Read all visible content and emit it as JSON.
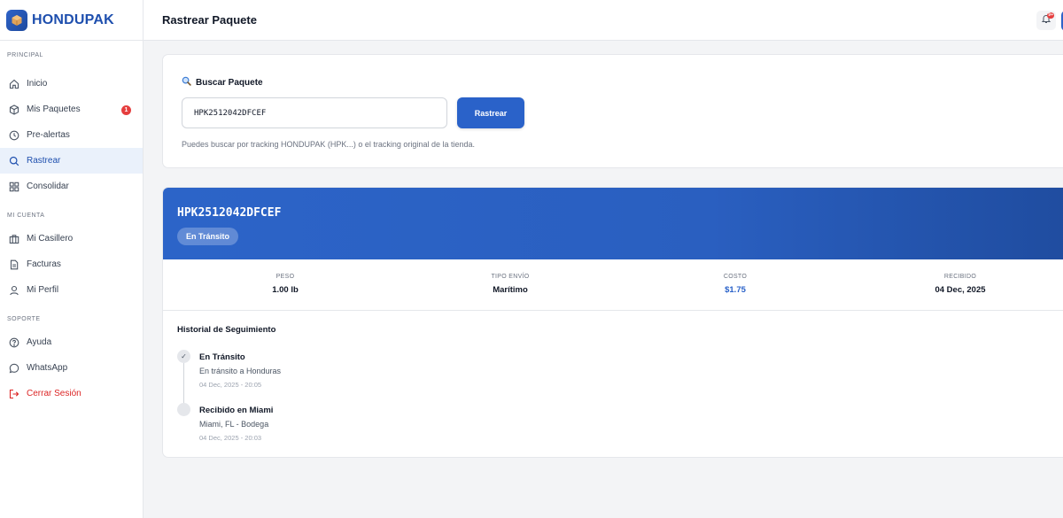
{
  "brand": {
    "name": "HONDUPAK"
  },
  "sidebar": {
    "sections": [
      {
        "label": "PRINCIPAL"
      },
      {
        "label": "MI CUENTA"
      },
      {
        "label": "SOPORTE"
      }
    ],
    "items": [
      {
        "label": "Inicio",
        "icon": "home-icon"
      },
      {
        "label": "Mis Paquetes",
        "icon": "box-icon",
        "badge": "1"
      },
      {
        "label": "Pre-alertas",
        "icon": "clock-icon"
      },
      {
        "label": "Rastrear",
        "icon": "search-icon",
        "active": true
      },
      {
        "label": "Consolidar",
        "icon": "grid-icon"
      },
      {
        "label": "Mi Casillero",
        "icon": "briefcase-icon"
      },
      {
        "label": "Facturas",
        "icon": "document-icon"
      },
      {
        "label": "Mi Perfil",
        "icon": "user-icon"
      },
      {
        "label": "Ayuda",
        "icon": "help-icon"
      },
      {
        "label": "WhatsApp",
        "icon": "chat-icon"
      },
      {
        "label": "Cerrar Sesión",
        "icon": "logout-icon",
        "color": "#dc2626"
      }
    ]
  },
  "header": {
    "title": "Rastrear Paquete",
    "notification_count": "9+"
  },
  "search": {
    "title": "Buscar Paquete",
    "value": "HPK2512042DFCEF",
    "button_label": "Rastrear",
    "hint": "Puedes buscar por tracking HONDUPAK (HPK...) o el tracking original de la tienda."
  },
  "result": {
    "tracking": "HPK2512042DFCEF",
    "status": "En Tránsito",
    "stats": [
      {
        "label": "PESO",
        "value": "1.00 lb"
      },
      {
        "label": "TIPO ENVÍO",
        "value": "Marítimo"
      },
      {
        "label": "COSTO",
        "value": "$1.75"
      },
      {
        "label": "RECIBIDO",
        "value": "04 Dec, 2025"
      }
    ],
    "history_title": "Historial de Seguimiento",
    "history": [
      {
        "title": "En Tránsito",
        "desc": "En tránsito a Honduras",
        "time": "04 Dec, 2025 - 20:05",
        "checked": true
      },
      {
        "title": "Recibido en Miami",
        "desc": "Miami, FL - Bodega",
        "time": "04 Dec, 2025 - 20:03",
        "checked": false
      }
    ]
  },
  "colors": {
    "accent": "#2a62c9",
    "danger": "#dc2626",
    "badge": "#e53e3e"
  }
}
